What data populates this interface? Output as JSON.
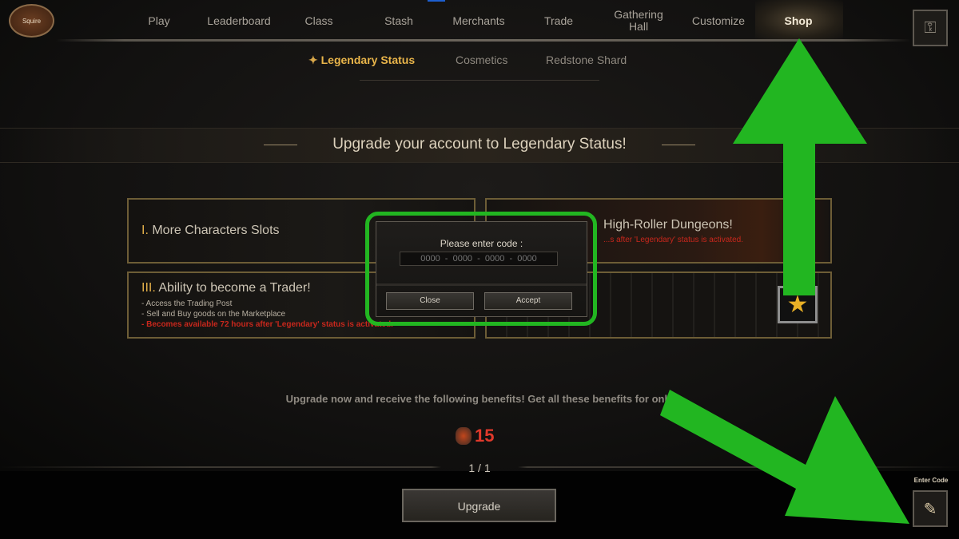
{
  "top_nav": {
    "rank_badge": "Squire",
    "items": [
      {
        "label": "Play"
      },
      {
        "label": "Leaderboard"
      },
      {
        "label": "Class"
      },
      {
        "label": "Stash"
      },
      {
        "label": "Merchants"
      },
      {
        "label": "Trade"
      },
      {
        "label": "Gathering Hall"
      },
      {
        "label": "Customize"
      },
      {
        "label": "Shop",
        "active": true
      }
    ]
  },
  "sub_tabs": [
    {
      "label": "Legendary Status",
      "active": true
    },
    {
      "label": "Cosmetics"
    },
    {
      "label": "Redstone Shard"
    }
  ],
  "banner_title": "Upgrade your account to Legendary Status!",
  "panels": [
    {
      "numeral": "I.",
      "title": "More Characters Slots"
    },
    {
      "title": "High-Roller Dungeons!",
      "note": "...s after 'Legendary' status is activated."
    },
    {
      "numeral": "III.",
      "title": "Ability to become a Trader!",
      "lines": [
        "- Access the Trading Post",
        "- Sell and Buy goods on the Marketplace"
      ],
      "note": "- Becomes available 72 hours after 'Legendary' status is activated."
    }
  ],
  "dialog": {
    "prompt": "Please enter code :",
    "code_placeholder": "0000  -  0000  -  0000  -  0000",
    "close_label": "Close",
    "accept_label": "Accept"
  },
  "offer": {
    "text": "Upgrade now and receive the following benefits! Get all these benefits for only",
    "price": "15",
    "price_color": "#e0392b",
    "currency_icon": "redstone-shard-icon",
    "pagination": "1 / 1",
    "upgrade_label": "Upgrade"
  },
  "enter_code": {
    "label": "Enter Code",
    "icon": "quill-scroll-icon"
  },
  "annotation_color": "#22b621"
}
